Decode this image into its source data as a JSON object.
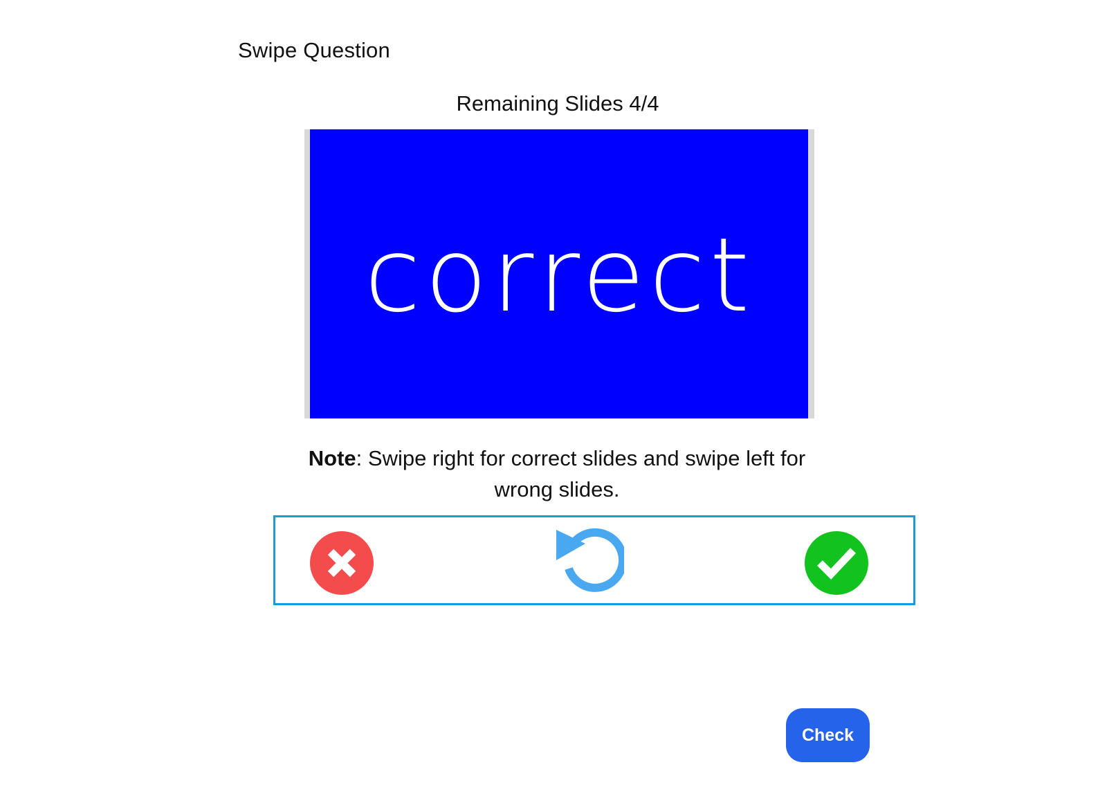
{
  "header": {
    "title": "Swipe Question"
  },
  "progress": {
    "label": "Remaining Slides 4/4"
  },
  "slide": {
    "text": "correct",
    "background_color": "#0000ff",
    "text_color": "#ffffff"
  },
  "note": {
    "prefix": "Note",
    "text": ": Swipe right for correct slides and swipe left for wrong slides."
  },
  "controls": {
    "wrong_icon": "x-circle-icon",
    "undo_icon": "undo-icon",
    "correct_icon": "check-circle-icon",
    "wrong_color": "#f44c4c",
    "undo_color": "#4aa8f0",
    "correct_color": "#12c21e",
    "border_color": "#1a9ad6"
  },
  "actions": {
    "check_label": "Check",
    "check_color": "#2563eb"
  }
}
